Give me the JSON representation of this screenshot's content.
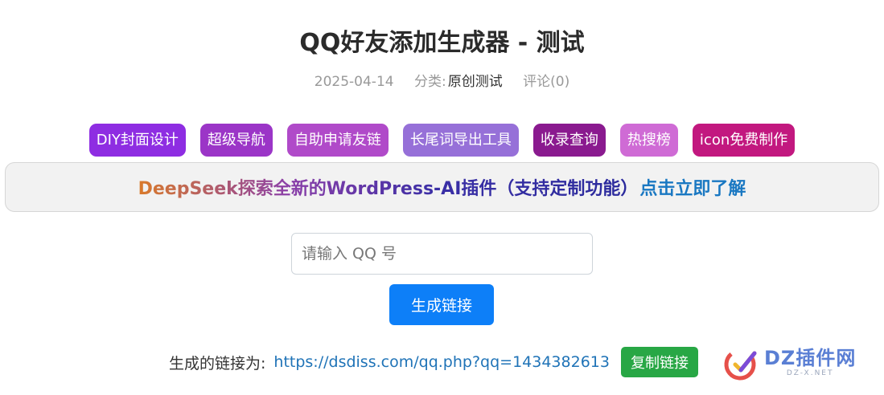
{
  "post": {
    "title": "QQ好友添加生成器 - 测试",
    "date": "2025-04-14",
    "category_label": "分类:",
    "category_value": "原创测试",
    "comments": "评论(0)"
  },
  "tags": [
    {
      "label": "DIY封面设计",
      "color": "#8e2de2"
    },
    {
      "label": "超级导航",
      "color": "#9b35c7"
    },
    {
      "label": "自助申请友链",
      "color": "#b04ac9"
    },
    {
      "label": "长尾词导出工具",
      "color": "#9670d8"
    },
    {
      "label": "收录查询",
      "color": "#8a1a8f"
    },
    {
      "label": "热搜榜",
      "color": "#cf6bd5"
    },
    {
      "label": "icon免费制作",
      "color": "#c2187f"
    }
  ],
  "promo": {
    "text": "DeepSeek探索全新的WordPress-AI插件（支持定制功能）",
    "cta": "点击立即了解"
  },
  "form": {
    "qq_placeholder": "请输入 QQ 号",
    "qq_value": "",
    "generate_label": "生成链接"
  },
  "result": {
    "label": "生成的链接为:",
    "link": "https://dsdiss.com/qq.php?qq=1434382613",
    "copy_label": "复制链接"
  },
  "watermark": {
    "main": "DZ插件网",
    "sub": "DZ-X.NET"
  }
}
